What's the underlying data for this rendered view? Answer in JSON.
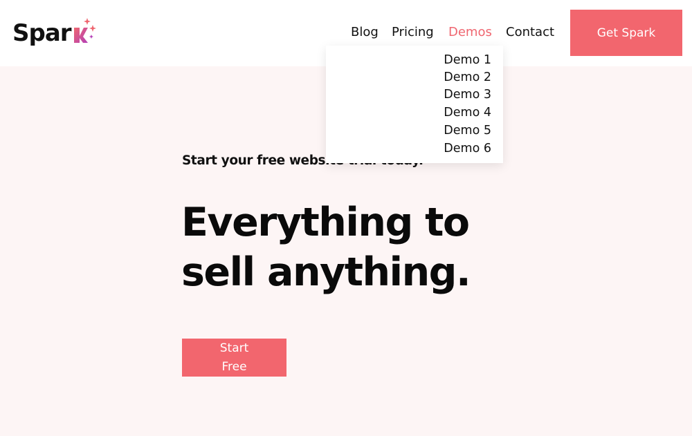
{
  "brand": {
    "logo_text": "Spar",
    "logo_letter": "k",
    "accent_color": "#f2666e",
    "logo_gradient": [
      "#ef6670",
      "#b33fb7"
    ]
  },
  "nav": {
    "items": [
      {
        "label": "Blog"
      },
      {
        "label": "Pricing"
      },
      {
        "label": "Demos",
        "active": true
      },
      {
        "label": "Contact"
      }
    ],
    "cta_label": "Get Spark"
  },
  "dropdown": {
    "items": [
      {
        "label": "Demo 1"
      },
      {
        "label": "Demo 2"
      },
      {
        "label": "Demo 3"
      },
      {
        "label": "Demo 4"
      },
      {
        "label": "Demo 5"
      },
      {
        "label": "Demo 6"
      }
    ]
  },
  "hero": {
    "kicker": "Start your free website trial today.",
    "headline_line1": "Everything to",
    "headline_line2": "sell anything.",
    "button_label": "Start Free"
  }
}
